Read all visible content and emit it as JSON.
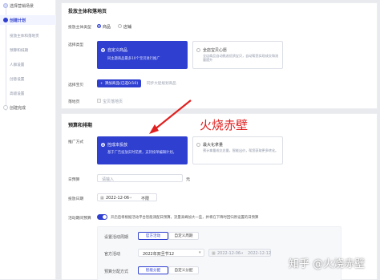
{
  "sidebar": {
    "items": [
      {
        "label": "选择营销场景"
      },
      {
        "label": "创建计划"
      },
      {
        "label": "投放主体和落地页"
      },
      {
        "label": "预算和排期"
      },
      {
        "label": "人群设置"
      },
      {
        "label": "创意设置"
      },
      {
        "label": "高级设置"
      },
      {
        "label": "创建完成"
      }
    ]
  },
  "section1": {
    "title": "投放主体和落地页",
    "subject_type": {
      "label": "投放主体类型",
      "options": [
        "商品",
        "店铺"
      ]
    },
    "select_type": {
      "label": "选择类型",
      "options": [
        {
          "title": "自定义商品",
          "desc": "同主题商品最多10个宝贝进行推广"
        },
        {
          "title": "全店宝贝心愿",
          "desc": "全店商品自动挑选优质宝贝，自动帮您实现成交和流量提升"
        }
      ]
    },
    "choose_goods": {
      "label": "选择宝贝",
      "button": "添加商品(已选0/10)",
      "hint": "同步大促规划商品"
    },
    "landing_page": {
      "label": "落地页",
      "value": "宝贝落地页"
    }
  },
  "section2": {
    "title": "预算和排期",
    "promo_mode": {
      "label": "推广方式",
      "options": [
        {
          "title": "控成本投放",
          "desc": "基于广告投放实时花费，支持按单编辑计划。"
        },
        {
          "title": "最大化拿量",
          "desc": "预计拿量成交总量，智能出价，帮您获取更多转化。"
        }
      ]
    },
    "daily_budget": {
      "label": "日预算",
      "placeholder": "请输入",
      "unit": "元"
    },
    "schedule": {
      "label": "投放日期",
      "start": "2022-12-06",
      "end": "不限"
    },
    "smart_budget": {
      "label": "活动期间预算",
      "desc": "开启后将根据活动平台智能调配日预算，流量高峰加大一些，并将在下降时回归原设置的日预算"
    },
    "activity": {
      "period_label": "设置活动周期",
      "period_options": [
        "官方活动",
        "自定义周期"
      ],
      "official_label": "官方活动",
      "official_value": "2022年双旦节12",
      "date_start": "2022-12-06",
      "date_end": "2022-12-12",
      "allocation_label": "预算分配方式",
      "allocation_options": [
        "智能分配",
        "自定义分配"
      ]
    }
  },
  "annotation": {
    "text": "火烧赤壁"
  },
  "watermark": {
    "text": "知乎 @火烧赤壁"
  },
  "colors": {
    "accent": "#2f3fcf",
    "annotation": "#e02020"
  }
}
